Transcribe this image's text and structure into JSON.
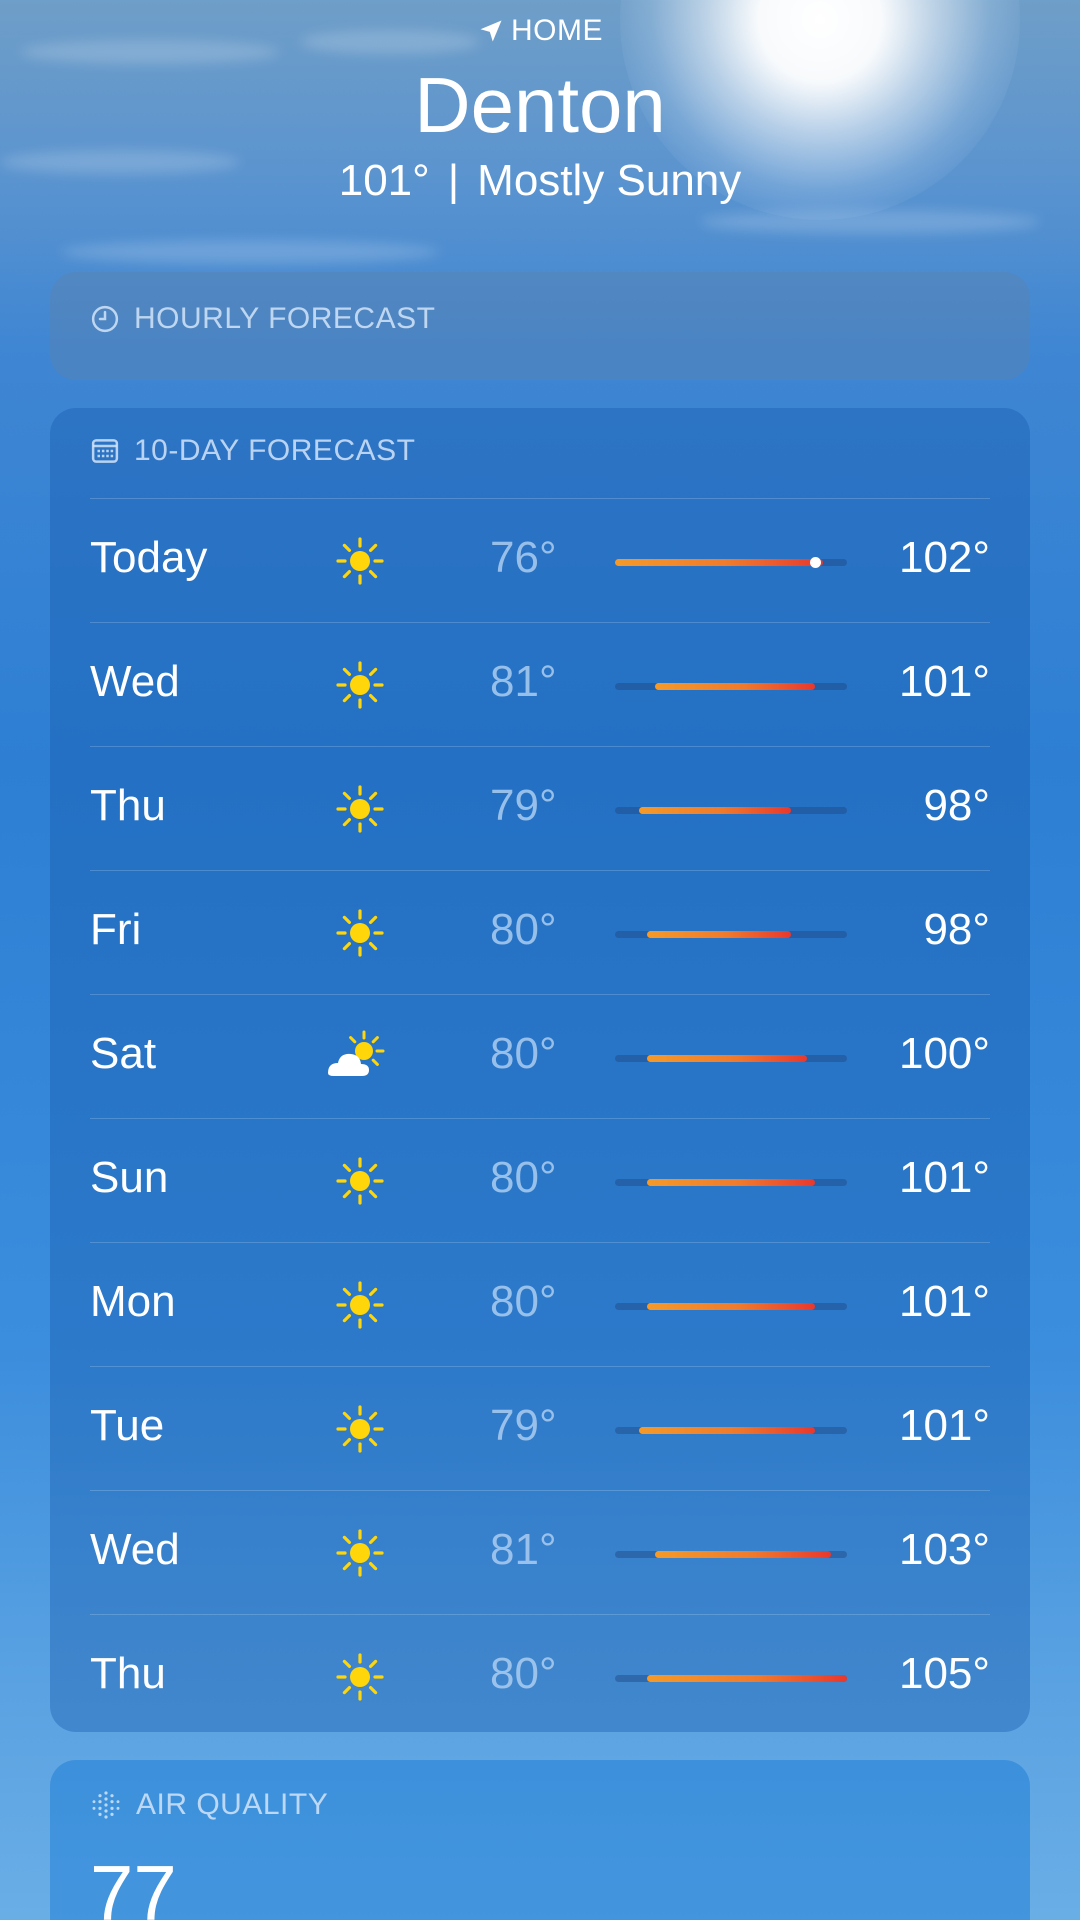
{
  "header": {
    "location_label": "HOME",
    "city": "Denton",
    "current_temp": "101°",
    "separator": "|",
    "condition": "Mostly Sunny"
  },
  "hourly": {
    "title": "HOURLY FORECAST"
  },
  "ten_day": {
    "title": "10-DAY FORECAST",
    "range_min": 76,
    "range_max": 105,
    "current_temp_value": 101,
    "days": [
      {
        "day": "Today",
        "icon": "sun-icon",
        "low": "76°",
        "high": "102°",
        "low_value": 76,
        "high_value": 102
      },
      {
        "day": "Wed",
        "icon": "sun-icon",
        "low": "81°",
        "high": "101°",
        "low_value": 81,
        "high_value": 101
      },
      {
        "day": "Thu",
        "icon": "sun-icon",
        "low": "79°",
        "high": "98°",
        "low_value": 79,
        "high_value": 98
      },
      {
        "day": "Fri",
        "icon": "sun-icon",
        "low": "80°",
        "high": "98°",
        "low_value": 80,
        "high_value": 98
      },
      {
        "day": "Sat",
        "icon": "partly-cloudy-icon",
        "low": "80°",
        "high": "100°",
        "low_value": 80,
        "high_value": 100
      },
      {
        "day": "Sun",
        "icon": "sun-icon",
        "low": "80°",
        "high": "101°",
        "low_value": 80,
        "high_value": 101
      },
      {
        "day": "Mon",
        "icon": "sun-icon",
        "low": "80°",
        "high": "101°",
        "low_value": 80,
        "high_value": 101
      },
      {
        "day": "Tue",
        "icon": "sun-icon",
        "low": "79°",
        "high": "101°",
        "low_value": 79,
        "high_value": 101
      },
      {
        "day": "Wed",
        "icon": "sun-icon",
        "low": "81°",
        "high": "103°",
        "low_value": 81,
        "high_value": 103
      },
      {
        "day": "Thu",
        "icon": "sun-icon",
        "low": "80°",
        "high": "105°",
        "low_value": 80,
        "high_value": 105
      }
    ]
  },
  "air_quality": {
    "title": "AIR QUALITY",
    "value": "77"
  },
  "colors": {
    "sun": "#ffd60a",
    "bar_start": "#f59a2a",
    "bar_end": "#e8382e"
  }
}
